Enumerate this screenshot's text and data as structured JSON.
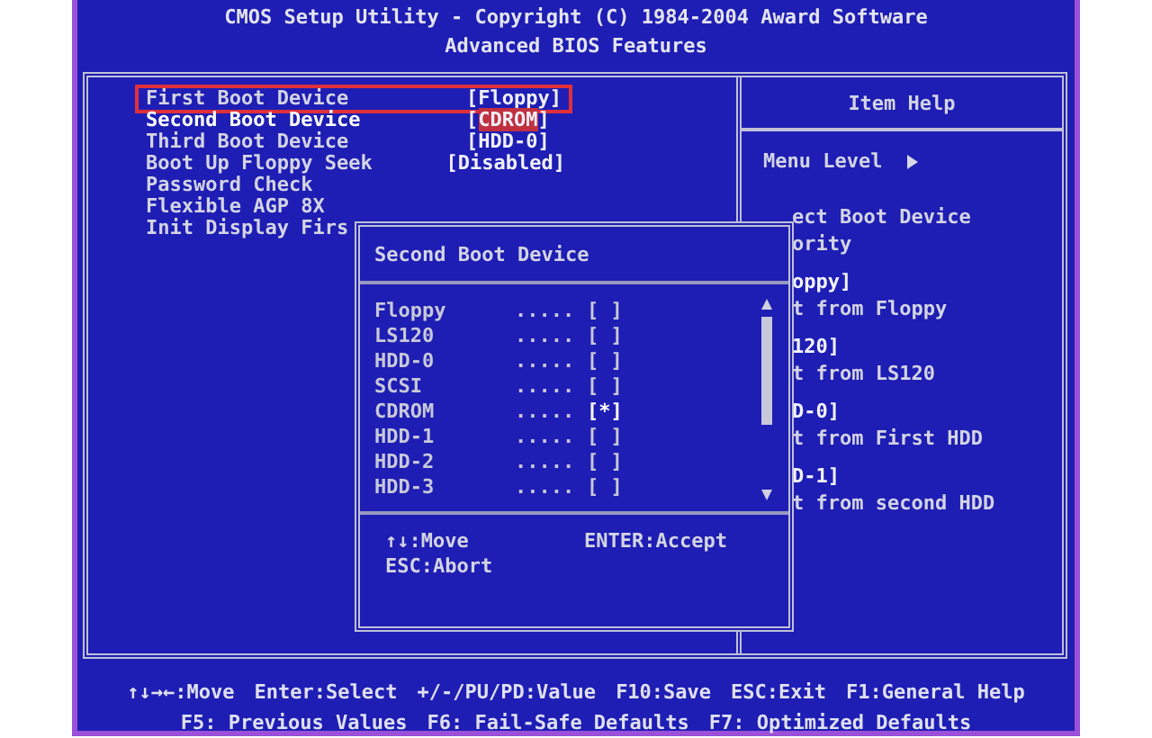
{
  "header": {
    "title": "CMOS Setup Utility - Copyright (C) 1984-2004 Award Software",
    "subtitle": "Advanced BIOS Features"
  },
  "settings": [
    {
      "name": "First Boot Device",
      "value": "[Floppy]",
      "outlined": true,
      "selected": false
    },
    {
      "name": "Second Boot Device",
      "value_parts": [
        "[",
        "CDROM",
        "]"
      ],
      "outlined": false,
      "selected": true
    },
    {
      "name": "Third Boot Device",
      "value": "[HDD-0]",
      "outlined": false,
      "selected": false
    },
    {
      "name": "Boot Up Floppy Seek",
      "value": "[Disabled]",
      "outlined": false,
      "selected": false
    },
    {
      "name": "Password Check",
      "outlined": false
    },
    {
      "name": "Flexible AGP 8X",
      "outlined": false
    },
    {
      "name": "Init Display Firs",
      "outlined": false
    }
  ],
  "help": {
    "title": "Item Help",
    "menu_level": "Menu Level",
    "lines": [
      {
        "kind": "text",
        "text": "ect Boot Device"
      },
      {
        "kind": "text",
        "text": "ority"
      },
      {
        "kind": "gap"
      },
      {
        "kind": "value",
        "text": "oppy]"
      },
      {
        "kind": "text",
        "text": "t from Floppy"
      },
      {
        "kind": "gap"
      },
      {
        "kind": "value",
        "text": "120]"
      },
      {
        "kind": "text",
        "text": "t from LS120"
      },
      {
        "kind": "gap"
      },
      {
        "kind": "value",
        "text": "D-0]"
      },
      {
        "kind": "text",
        "text": "t from First HDD"
      },
      {
        "kind": "gap"
      },
      {
        "kind": "value",
        "text": "D-1]"
      },
      {
        "kind": "text",
        "text": "t from second HDD"
      }
    ]
  },
  "popup": {
    "title": "Second Boot Device",
    "options": [
      {
        "name": "Floppy",
        "leader": ".....",
        "mark": "[ ]",
        "selected": false
      },
      {
        "name": "LS120",
        "leader": ".....",
        "mark": "[ ]",
        "selected": false
      },
      {
        "name": "HDD-0",
        "leader": ".....",
        "mark": "[ ]",
        "selected": false
      },
      {
        "name": "SCSI",
        "leader": ".....",
        "mark": "[ ]",
        "selected": false
      },
      {
        "name": "CDROM",
        "leader": ".....",
        "mark": "[*]",
        "selected": true
      },
      {
        "name": "HDD-1",
        "leader": ".....",
        "mark": "[ ]",
        "selected": false
      },
      {
        "name": "HDD-2",
        "leader": ".....",
        "mark": "[ ]",
        "selected": false
      },
      {
        "name": "HDD-3",
        "leader": ".....",
        "mark": "[ ]",
        "selected": false
      }
    ],
    "keys": [
      [
        "↑↓:Move",
        "ENTER:Accept"
      ],
      [
        "ESC:Abort"
      ]
    ]
  },
  "footer": [
    [
      "↑↓→←:Move",
      "Enter:Select",
      "+/-/PU/PD:Value",
      "F10:Save",
      "ESC:Exit",
      "F1:General Help"
    ],
    [
      "F5: Previous Values",
      "F6: Fail-Safe Defaults",
      "F7: Optimized Defaults"
    ]
  ]
}
